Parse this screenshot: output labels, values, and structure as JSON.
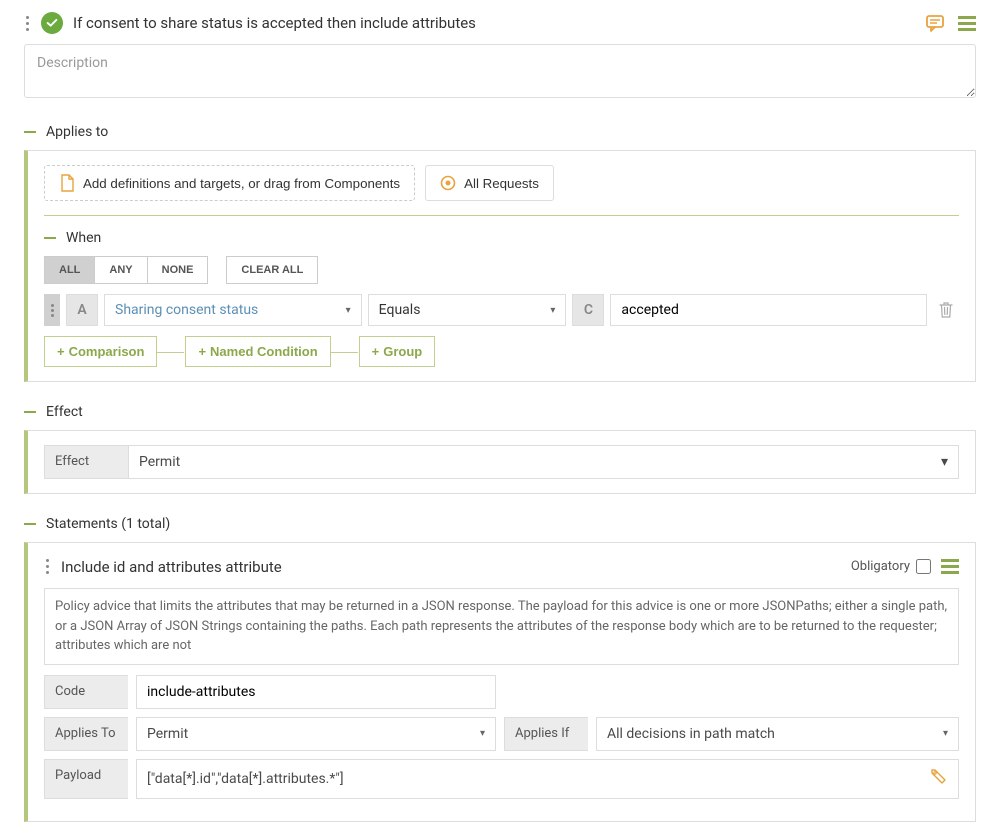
{
  "rule": {
    "title": "If consent to share status is accepted then include attributes",
    "description_placeholder": "Description"
  },
  "applies_to": {
    "label": "Applies to",
    "add_definitions": "Add definitions and targets, or drag from Components",
    "all_requests": "All Requests",
    "when_label": "When",
    "logic": {
      "all": "ALL",
      "any": "ANY",
      "none": "NONE",
      "clear_all": "CLEAR ALL"
    },
    "condition": {
      "badge_a": "A",
      "attribute": "Sharing consent status",
      "operator": "Equals",
      "badge_c": "C",
      "value": "accepted"
    },
    "add": {
      "comparison": "Comparison",
      "named_condition": "Named Condition",
      "group": "Group"
    }
  },
  "effect": {
    "label": "Effect",
    "field_label": "Effect",
    "value": "Permit"
  },
  "statements": {
    "header": "Statements (1 total)",
    "item": {
      "title": "Include id and attributes attribute",
      "obligatory_label": "Obligatory",
      "description": "Policy advice that limits the attributes that may be returned in a JSON response. The payload for this advice is one or more JSONPaths; either a single path, or a JSON Array of JSON Strings containing the paths. Each path represents the attributes of the response body which are to be returned to the requester; attributes which are not",
      "code_label": "Code",
      "code_value": "include-attributes",
      "applies_to_label": "Applies To",
      "applies_to_value": "Permit",
      "applies_if_label": "Applies If",
      "applies_if_value": "All decisions in path match",
      "payload_label": "Payload",
      "payload_value": "[\"data[*].id\",\"data[*].attributes.*\"]"
    }
  }
}
